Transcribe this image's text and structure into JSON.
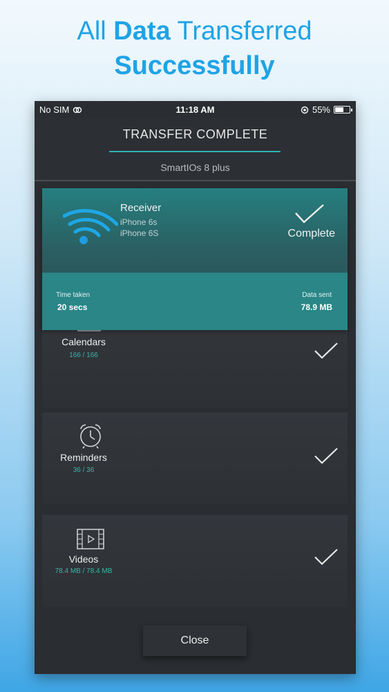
{
  "headline": {
    "line1_regular": "All",
    "line1_bold": "Data",
    "line1_rest": "Transferred",
    "line2_bold": "Successfully"
  },
  "status_bar": {
    "carrier": "No SIM",
    "time": "11:18 AM",
    "battery": "55%"
  },
  "header": {
    "title": "TRANSFER COMPLETE",
    "device": "SmartIOs 8 plus"
  },
  "receiver_card": {
    "label": "Receiver",
    "device_line1": "iPhone 6s",
    "device_line2": "iPhone 6S",
    "status": "Complete"
  },
  "stats": {
    "time_taken_label": "Time taken",
    "time_taken_value": "20 secs",
    "data_sent_label": "Data sent",
    "data_sent_value": "78.9 MB"
  },
  "items": [
    {
      "label": "Calendars",
      "count": "166 / 166",
      "icon": "calendar-icon"
    },
    {
      "label": "Reminders",
      "count": "36 / 36",
      "icon": "alarm-clock-icon"
    },
    {
      "label": "Videos",
      "count": "78.4 MB / 78.4 MB",
      "icon": "video-icon"
    }
  ],
  "close_button": {
    "label": "Close"
  },
  "colors": {
    "accent_teal": "#2fb3b7",
    "headline_blue": "#1fa3e6",
    "count_green": "#3ab5a7"
  }
}
